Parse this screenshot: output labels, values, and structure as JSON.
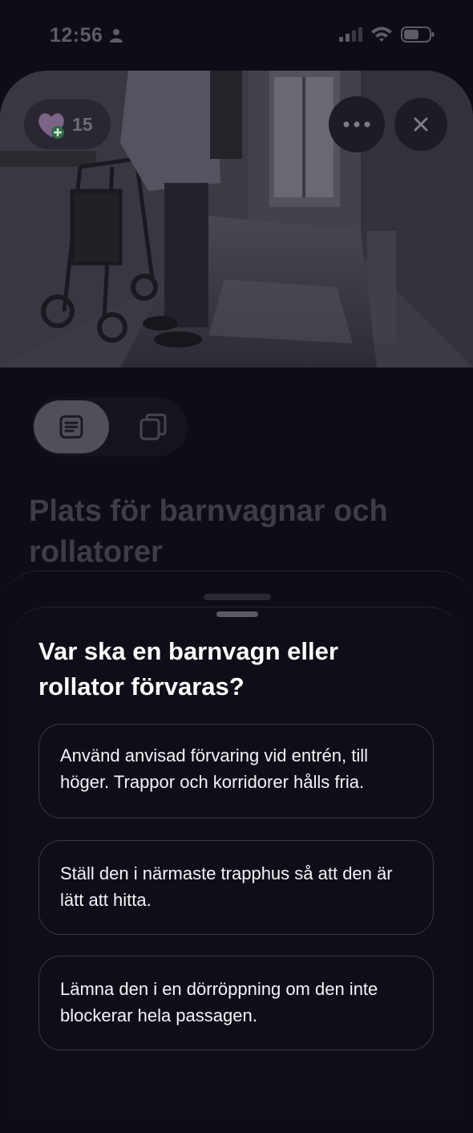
{
  "status_bar": {
    "time": "12:56",
    "icons": [
      "person-icon",
      "signal-icon",
      "wifi-icon",
      "battery-icon"
    ]
  },
  "hero": {
    "badge_count": "15",
    "badge_icon": "heart-plus-icon",
    "more_icon": "ellipsis-icon",
    "close_icon": "close-icon"
  },
  "segment": {
    "active_icon": "document-icon",
    "inactive_icon": "cards-icon"
  },
  "page": {
    "title": "Plats för barnvagnar och rollatorer"
  },
  "sheet": {
    "question": "Var ska en barnvagn eller rollator förvaras?",
    "options": [
      {
        "label": "Använd anvisad förvaring vid entrén, till höger. Trappor och korridorer hålls fria."
      },
      {
        "label": "Ställ den i närmaste trapphus så att den är lätt att hitta."
      },
      {
        "label": "Lämna den i en dörröppning om den inte blockerar hela passagen."
      }
    ]
  },
  "colors": {
    "background": "#0e0c17",
    "overlay_text": "#3e3c46",
    "option_border": "#3a3845"
  }
}
